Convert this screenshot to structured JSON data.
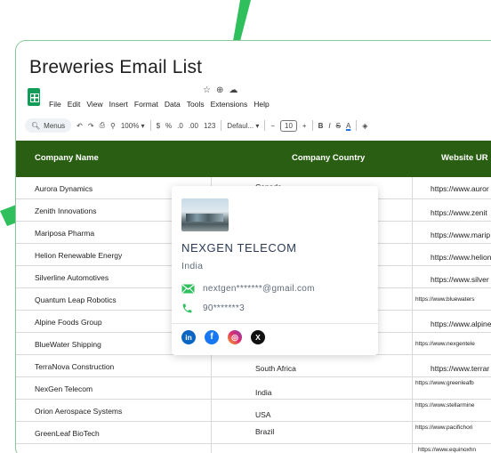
{
  "doc": {
    "title": "Breweries Email List"
  },
  "menu": [
    "File",
    "Edit",
    "View",
    "Insert",
    "Format",
    "Data",
    "Tools",
    "Extensions",
    "Help"
  ],
  "toolbar": {
    "menus_label": "Menus",
    "zoom": "100%",
    "currency": "$",
    "percent": "%",
    "dec_decrease": ".0",
    "dec_increase": ".00",
    "number_format": "123",
    "font": "Defaul...",
    "minus": "−",
    "font_size": "10",
    "plus": "+",
    "bold": "B",
    "italic": "I",
    "strike": "S",
    "text_color": "A"
  },
  "table": {
    "headers": [
      "Company Name",
      "Company Country",
      "Website UR"
    ],
    "rows": [
      {
        "name": "Aurora Dynamics",
        "country": "Canada",
        "website": "https://www.auror"
      },
      {
        "name": "Zenith Innovations",
        "country": "",
        "website": "https://www.zenit"
      },
      {
        "name": "Mariposa Pharma",
        "country": "",
        "website": "https://www.marip"
      },
      {
        "name": "Helion Renewable Energy",
        "country": "",
        "website": "https://www.helion"
      },
      {
        "name": "Silverline Automotives",
        "country": "",
        "website": "https://www.silver"
      },
      {
        "name": "Quantum Leap Robotics",
        "country": "",
        "website": "https://www.bluewaters"
      },
      {
        "name": "Alpine Foods Group",
        "country": "",
        "website": "https://www.alpine"
      },
      {
        "name": "BlueWater Shipping",
        "country": "",
        "website": "https://www.nexgentele"
      },
      {
        "name": "TerraNova Construction",
        "country": "South Africa",
        "website": "https://www.terrar"
      },
      {
        "name": "NexGen Telecom",
        "country": "India",
        "website": "https://www.greenleafb"
      },
      {
        "name": "Orion Aerospace Systems",
        "country": "USA",
        "website": "https://www.stellarmine"
      },
      {
        "name": "GreenLeaf BioTech",
        "country": "Brazil",
        "website": "https://www.pacifichori"
      },
      {
        "name": "",
        "country": "",
        "website": "https://www.equinoxhn"
      }
    ]
  },
  "card": {
    "company": "NEXGEN TELECOM",
    "country": "India",
    "email": "nextgen*******@gmail.com",
    "phone": "90*******3",
    "socials": [
      "linkedin-icon",
      "facebook-icon",
      "instagram-icon",
      "x-icon"
    ]
  },
  "colors": {
    "header_green": "#2a5f13",
    "accent_green": "#2fbf5d",
    "border_green": "#8cc79a"
  }
}
